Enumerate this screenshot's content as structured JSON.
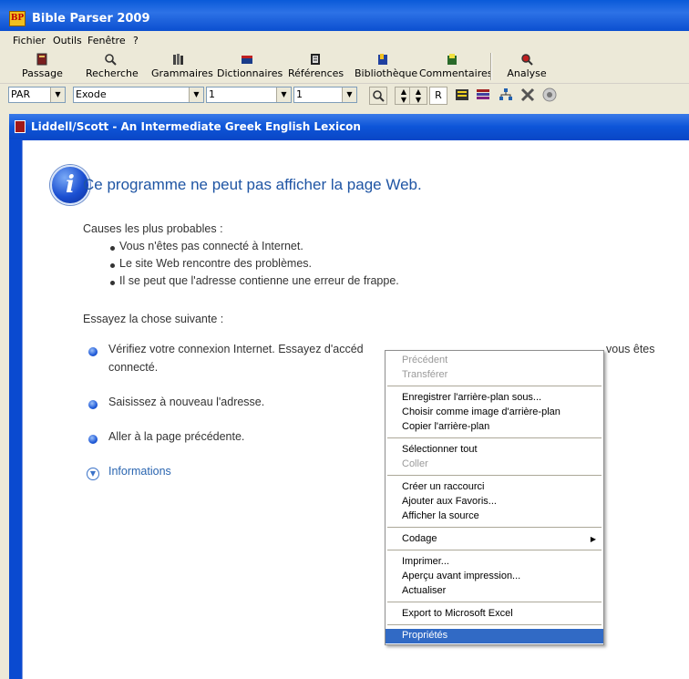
{
  "app": {
    "title": "Bible Parser 2009",
    "icon_text": "BP"
  },
  "menu": [
    "Fichier",
    "Outils",
    "Fenêtre",
    "?"
  ],
  "toolbar": {
    "buttons": [
      {
        "label": "Passage",
        "icon": "book-icon"
      },
      {
        "label": "Recherche",
        "icon": "search-icon"
      },
      {
        "label": "Grammaires",
        "icon": "books-icon"
      },
      {
        "label": "Dictionnaires",
        "icon": "dictionary-icon"
      },
      {
        "label": "Références",
        "icon": "reference-icon"
      },
      {
        "label": "Bibliothèque",
        "icon": "library-icon"
      },
      {
        "label": "Commentaires",
        "icon": "commentary-icon"
      },
      {
        "label": "Analyse",
        "icon": "analysis-icon"
      }
    ]
  },
  "selectors": {
    "version": "PAR",
    "book": "Exode",
    "chapter": "1",
    "verse": "1",
    "r_button": "R"
  },
  "document_window": {
    "title": "Liddell/Scott - An Intermediate Greek English Lexicon"
  },
  "error_page": {
    "title": "Ce programme ne peut pas afficher la page Web.",
    "causes_heading": "Causes les plus probables :",
    "causes": [
      "Vous n'êtes pas connecté à Internet.",
      "Le site Web rencontre des problèmes.",
      "Il se peut que l'adresse contienne une erreur de frappe."
    ],
    "try_heading": "Essayez la chose suivante :",
    "suggestions": [
      "Vérifiez votre connexion Internet. Essayez d'accéd",
      "vous êtes",
      "connecté.",
      "Saisissez à nouveau l'adresse.",
      "Aller à la page précédente."
    ],
    "info_link": "Informations"
  },
  "context_menu": {
    "items": [
      {
        "label": "Précédent",
        "disabled": true
      },
      {
        "label": "Transférer",
        "disabled": true
      },
      {
        "label": "Enregistrer l'arrière-plan sous..."
      },
      {
        "label": "Choisir comme image d'arrière-plan"
      },
      {
        "label": "Copier l'arrière-plan"
      },
      {
        "label": "Sélectionner tout"
      },
      {
        "label": "Coller",
        "disabled": true
      },
      {
        "label": "Créer un raccourci"
      },
      {
        "label": "Ajouter aux Favoris..."
      },
      {
        "label": "Afficher la source"
      },
      {
        "label": "Codage",
        "submenu": true
      },
      {
        "label": "Imprimer..."
      },
      {
        "label": "Aperçu avant impression..."
      },
      {
        "label": "Actualiser"
      },
      {
        "label": "Export to Microsoft Excel"
      },
      {
        "label": "Propriétés",
        "selected": true
      }
    ],
    "submenu_arrow": "▶"
  },
  "colors": {
    "titlebar": "#0a5ad8",
    "selection": "#316ac5",
    "error_title": "#1f55a4"
  }
}
